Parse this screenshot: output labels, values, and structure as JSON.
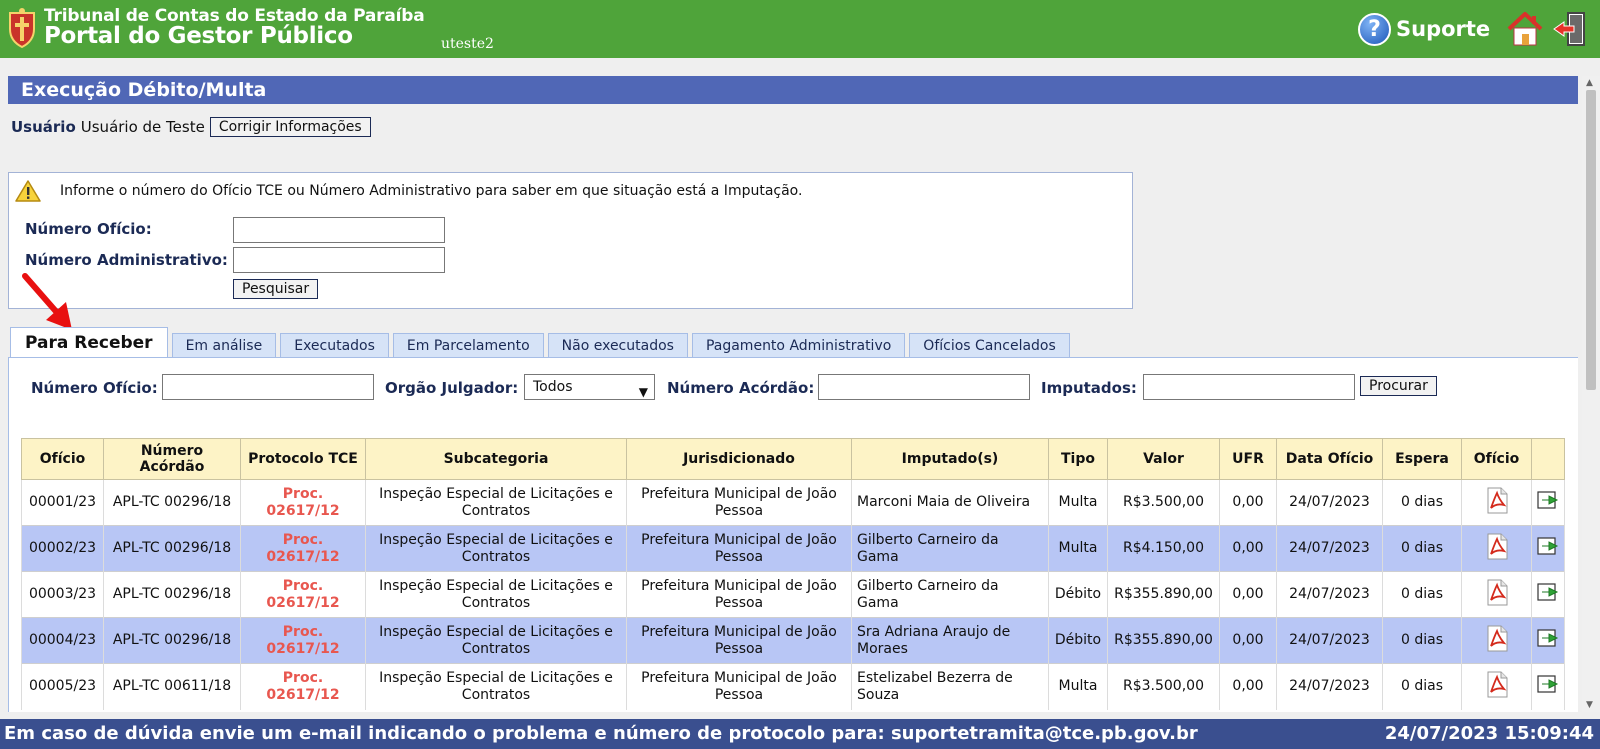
{
  "header": {
    "org_name": "Tribunal de Contas do Estado da Paraíba",
    "portal_name": "Portal do Gestor Público",
    "username": "uteste2",
    "support_label": "Suporte"
  },
  "page_title": "Execução Débito/Multa",
  "user": {
    "label": "Usuário",
    "name": "Usuário de Teste",
    "fix_button": "Corrigir Informações"
  },
  "search": {
    "info_text": "Informe o número do Ofício TCE ou Número Administrativo para saber em que situação está a Imputação.",
    "oficio_label": "Número Ofício:",
    "oficio_value": "",
    "admin_label": "Número Administrativo:",
    "admin_value": "",
    "button": "Pesquisar"
  },
  "tabs": [
    {
      "label": "Para Receber",
      "active": true
    },
    {
      "label": "Em análise"
    },
    {
      "label": "Executados"
    },
    {
      "label": "Em Parcelamento"
    },
    {
      "label": "Não executados"
    },
    {
      "label": "Pagamento Administrativo"
    },
    {
      "label": "Ofícios Cancelados"
    }
  ],
  "filters": {
    "oficio_label": "Número Ofício:",
    "orgao_label": "Orgão Julgador:",
    "orgao_selected": "Todos",
    "acordao_label": "Número Acórdão:",
    "imputados_label": "Imputados:",
    "search_button": "Procurar"
  },
  "table": {
    "headers": [
      "Ofício",
      "Número Acórdão",
      "Protocolo TCE",
      "Subcategoria",
      "Jurisdicionado",
      "Imputado(s)",
      "Tipo",
      "Valor",
      "UFR",
      "Data Ofício",
      "Espera",
      "Ofício",
      ""
    ],
    "rows": [
      {
        "oficio": "00001/23",
        "acordao": "APL-TC 00296/18",
        "protocolo": "Proc. 02617/12",
        "subcategoria": "Inspeção Especial de Licitações e Contratos",
        "jurisdicionado": "Prefeitura Municipal de João Pessoa",
        "imputado": "Marconi Maia de Oliveira",
        "tipo": "Multa",
        "valor": "R$3.500,00",
        "ufr": "0,00",
        "data": "24/07/2023",
        "espera": "0 dias"
      },
      {
        "oficio": "00002/23",
        "acordao": "APL-TC 00296/18",
        "protocolo": "Proc. 02617/12",
        "subcategoria": "Inspeção Especial de Licitações e Contratos",
        "jurisdicionado": "Prefeitura Municipal de João Pessoa",
        "imputado": "Gilberto Carneiro da Gama",
        "tipo": "Multa",
        "valor": "R$4.150,00",
        "ufr": "0,00",
        "data": "24/07/2023",
        "espera": "0 dias"
      },
      {
        "oficio": "00003/23",
        "acordao": "APL-TC 00296/18",
        "protocolo": "Proc. 02617/12",
        "subcategoria": "Inspeção Especial de Licitações e Contratos",
        "jurisdicionado": "Prefeitura Municipal de João Pessoa",
        "imputado": "Gilberto Carneiro da Gama",
        "tipo": "Débito",
        "valor": "R$355.890,00",
        "ufr": "0,00",
        "data": "24/07/2023",
        "espera": "0 dias"
      },
      {
        "oficio": "00004/23",
        "acordao": "APL-TC 00296/18",
        "protocolo": "Proc. 02617/12",
        "subcategoria": "Inspeção Especial de Licitações e Contratos",
        "jurisdicionado": "Prefeitura Municipal de João Pessoa",
        "imputado": "Sra Adriana Araujo de Moraes",
        "tipo": "Débito",
        "valor": "R$355.890,00",
        "ufr": "0,00",
        "data": "24/07/2023",
        "espera": "0 dias"
      },
      {
        "oficio": "00005/23",
        "acordao": "APL-TC 00611/18",
        "protocolo": "Proc. 02617/12",
        "subcategoria": "Inspeção Especial de Licitações e Contratos",
        "jurisdicionado": "Prefeitura Municipal de João Pessoa",
        "imputado": "Estelizabel Bezerra de Souza",
        "tipo": "Multa",
        "valor": "R$3.500,00",
        "ufr": "0,00",
        "data": "24/07/2023",
        "espera": "0 dias"
      }
    ]
  },
  "footer": {
    "message": "Em caso de dúvida envie um e-mail indicando o problema e número de protocolo para: suportetramita@tce.pb.gov.br",
    "datetime": "24/07/2023 15:09:44"
  },
  "icons": {
    "logo": "tce-coat-of-arms-icon",
    "support": "help-question-icon",
    "home": "home-icon",
    "exit": "exit-door-icon",
    "warning": "warning-icon",
    "pdf": "pdf-file-icon",
    "go": "green-arrow-right-icon"
  },
  "colors": {
    "header": "#4fa43a",
    "title_bar": "#5067b6",
    "footer": "#3a4f8f",
    "row_alt": "#b8c6f5",
    "table_header": "#fdf3c6",
    "protocol_text": "#e8574f"
  }
}
